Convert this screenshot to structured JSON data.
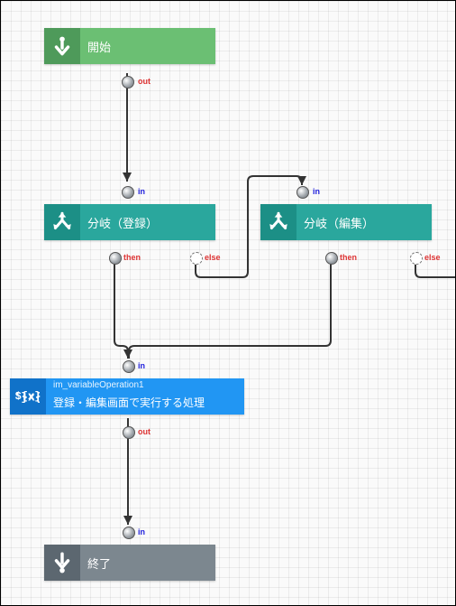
{
  "nodes": {
    "start": {
      "label": "開始",
      "out_label": "out",
      "color_icon": "#4e9a5a",
      "color_body": "#6bbf73"
    },
    "branch_register": {
      "label": "分岐（登録）",
      "in_label": "in",
      "then_label": "then",
      "else_label": "else",
      "color_icon": "#1c8f86",
      "color_body": "#2aa79d"
    },
    "branch_edit": {
      "label": "分岐（編集）",
      "in_label": "in",
      "then_label": "then",
      "else_label": "else",
      "color_icon": "#1c8f86",
      "color_body": "#2aa79d"
    },
    "variable_op": {
      "sublabel": "im_variableOperation1",
      "label": "登録・編集画面で実行する処理",
      "in_label": "in",
      "out_label": "out",
      "color_icon": "#1072c9",
      "color_body": "#2196f3"
    },
    "end": {
      "label": "終了",
      "in_label": "in",
      "color_icon": "#5c6770",
      "color_body": "#7c878f"
    }
  }
}
